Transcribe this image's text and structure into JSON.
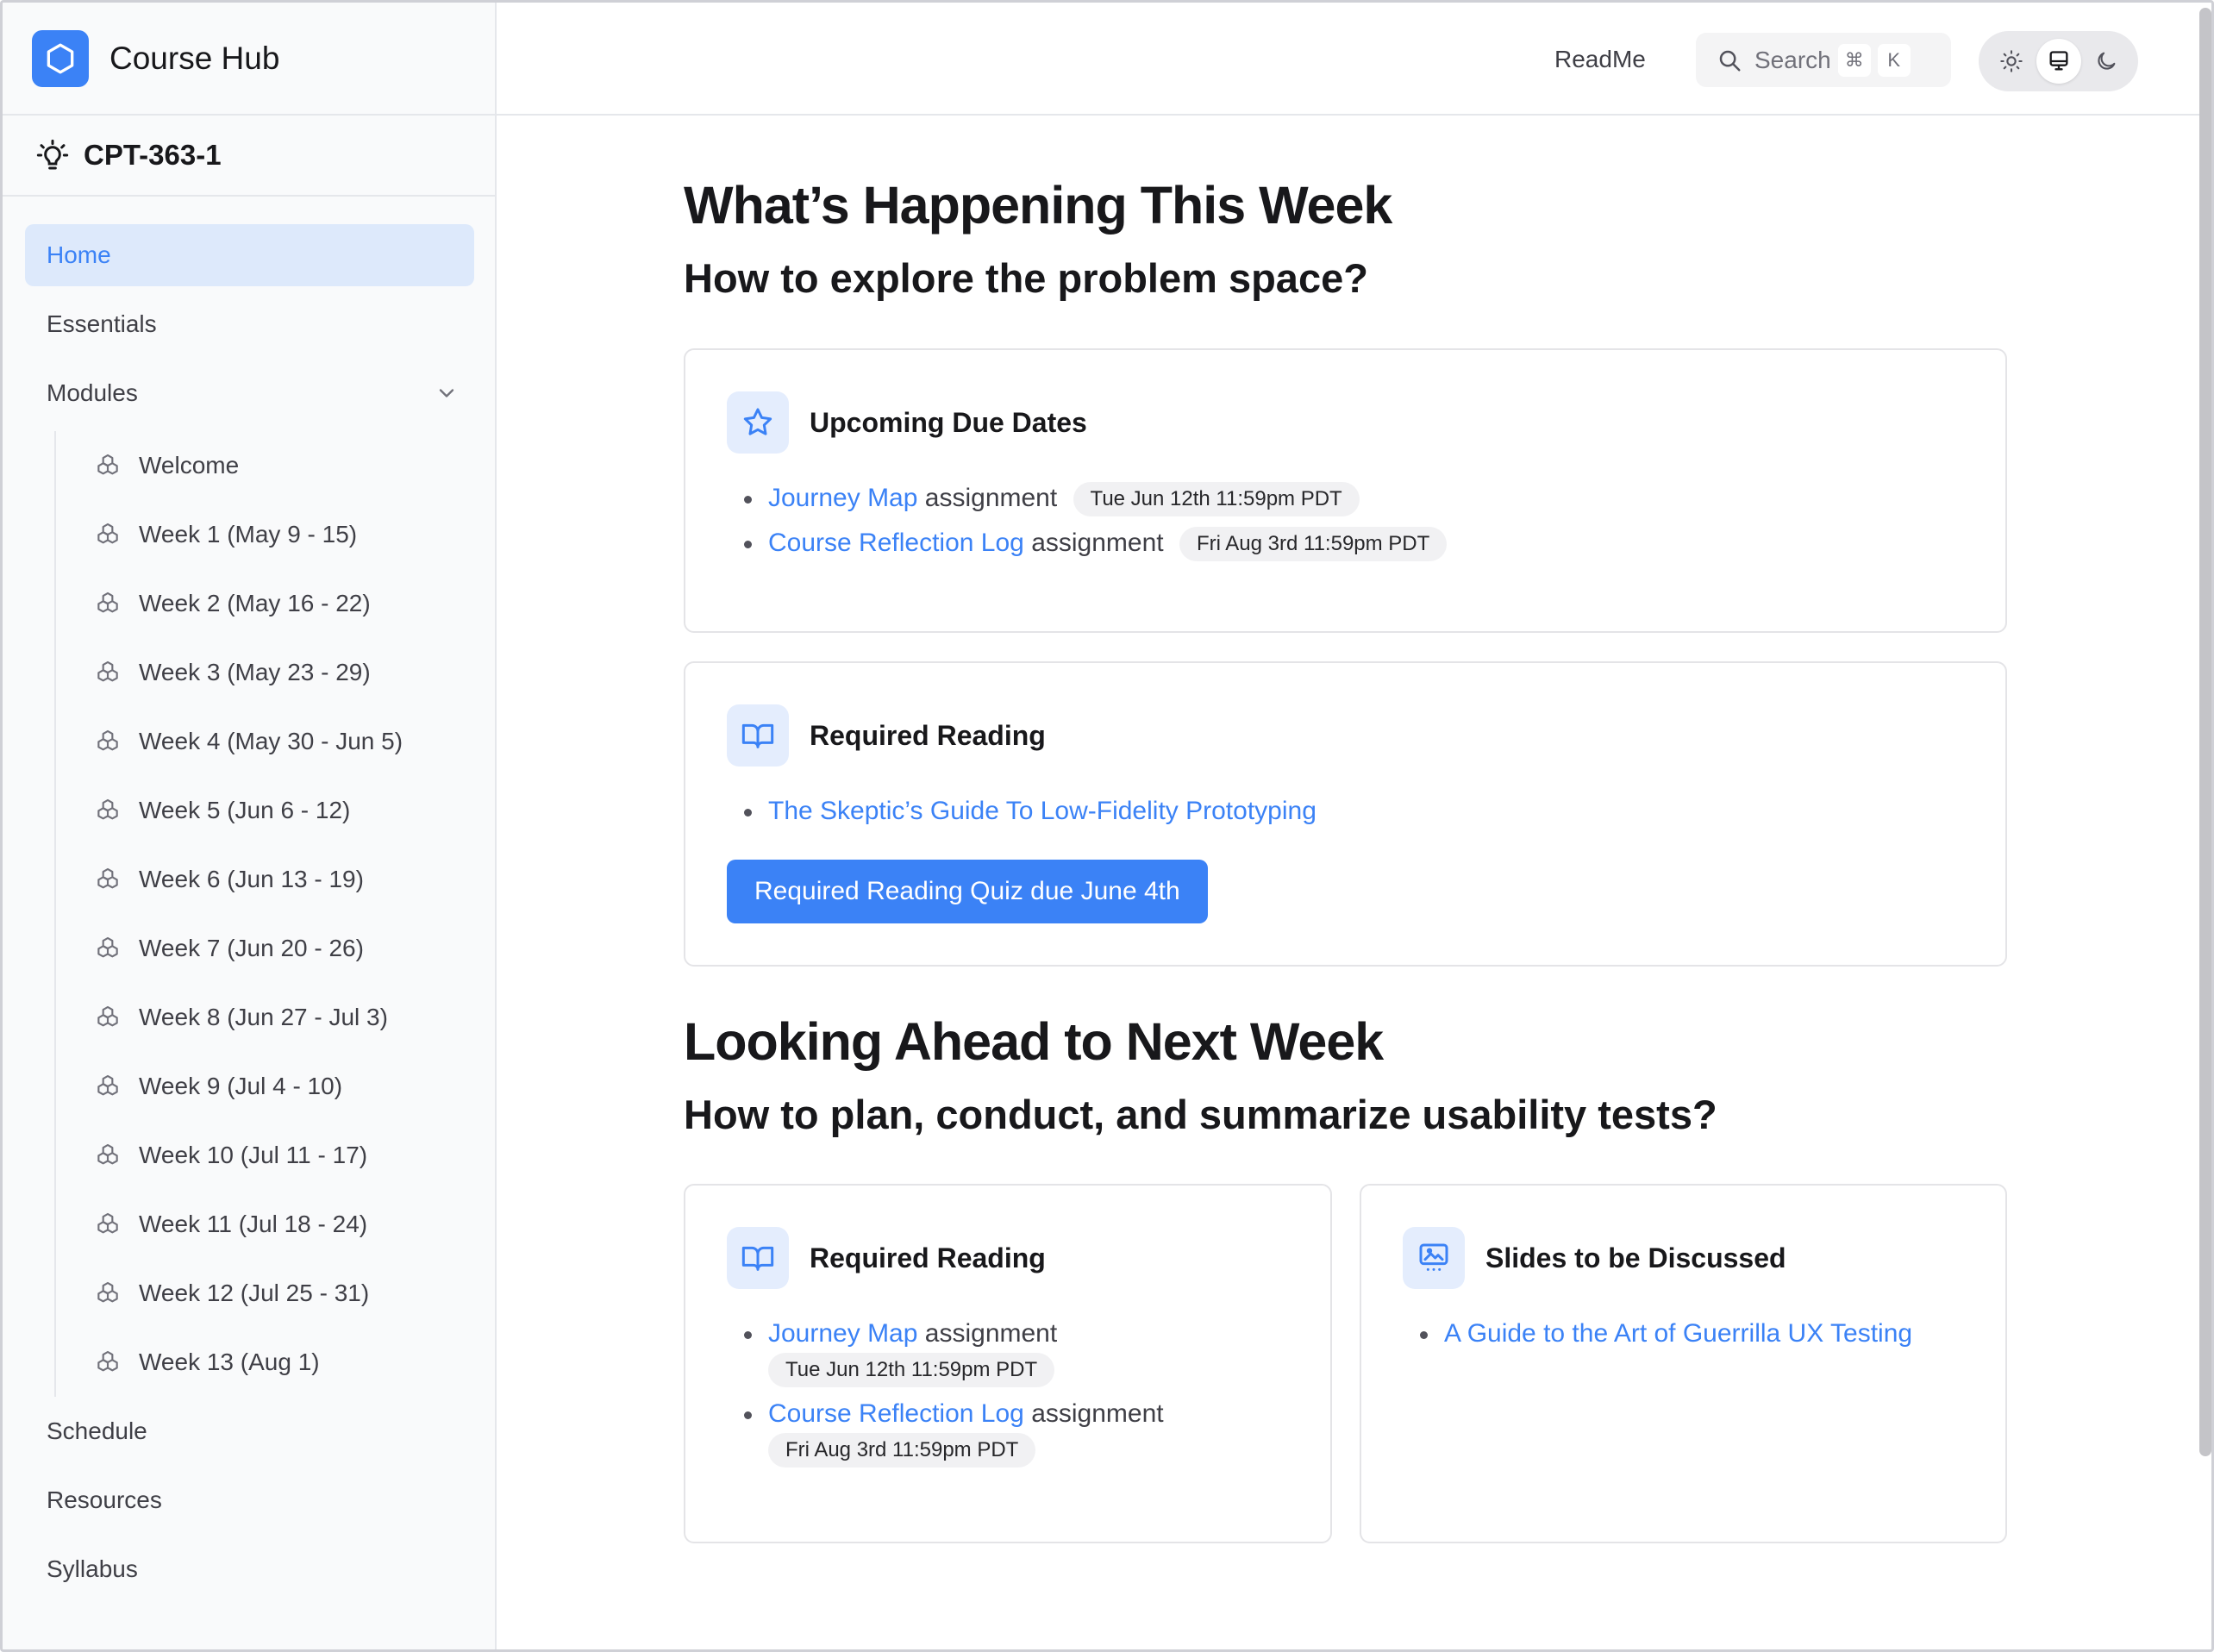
{
  "brand": {
    "name": "Course Hub"
  },
  "course": {
    "code": "CPT-363-1"
  },
  "nav": {
    "home": "Home",
    "essentials": "Essentials",
    "modules": "Modules",
    "modules_items": [
      "Welcome",
      "Week 1 (May 9 - 15)",
      "Week 2 (May 16 - 22)",
      "Week 3 (May 23 - 29)",
      "Week 4 (May 30 - Jun 5)",
      "Week 5 (Jun 6 - 12)",
      "Week 6 (Jun 13 - 19)",
      "Week 7 (Jun 20 - 26)",
      "Week 8 (Jun 27 - Jul 3)",
      "Week 9 (Jul 4 - 10)",
      "Week 10 (Jul 11 - 17)",
      "Week 11 (Jul 18 - 24)",
      "Week 12 (Jul 25 - 31)",
      "Week 13 (Aug 1)"
    ],
    "schedule": "Schedule",
    "resources": "Resources",
    "syllabus": "Syllabus"
  },
  "header": {
    "readme": "ReadMe",
    "search_label": "Search",
    "kbd_cmd": "⌘",
    "kbd_k": "K"
  },
  "this_week": {
    "title": "What’s Happening This Week",
    "subtitle": "How to explore the problem space?",
    "due": {
      "title": "Upcoming Due Dates",
      "items": [
        {
          "link": "Journey Map",
          "text": "assignment",
          "date": "Tue Jun 12th 11:59pm PDT"
        },
        {
          "link": "Course Reflection Log",
          "text": "assignment",
          "date": "Fri Aug 3rd 11:59pm PDT"
        }
      ]
    },
    "reading": {
      "title": "Required Reading",
      "link": "The Skeptic’s Guide To Low-Fidelity Prototyping",
      "button": "Required Reading Quiz due June 4th"
    }
  },
  "next_week": {
    "title": "Looking Ahead to Next Week",
    "subtitle": "How to plan, conduct, and summarize usability tests?",
    "reading": {
      "title": "Required Reading",
      "items": [
        {
          "link": "Journey Map",
          "text": "assignment",
          "date": "Tue Jun 12th 11:59pm PDT"
        },
        {
          "link": "Course Reflection Log",
          "text": "assignment",
          "date": "Fri Aug 3rd 11:59pm PDT"
        }
      ]
    },
    "slides": {
      "title": "Slides to be Discussed",
      "link": "A Guide to the Art of Guerrilla UX Testing"
    }
  },
  "colors": {
    "accent": "#3b82f6",
    "active_bg": "#dde9fb",
    "icon_bg": "#e4edfd"
  }
}
